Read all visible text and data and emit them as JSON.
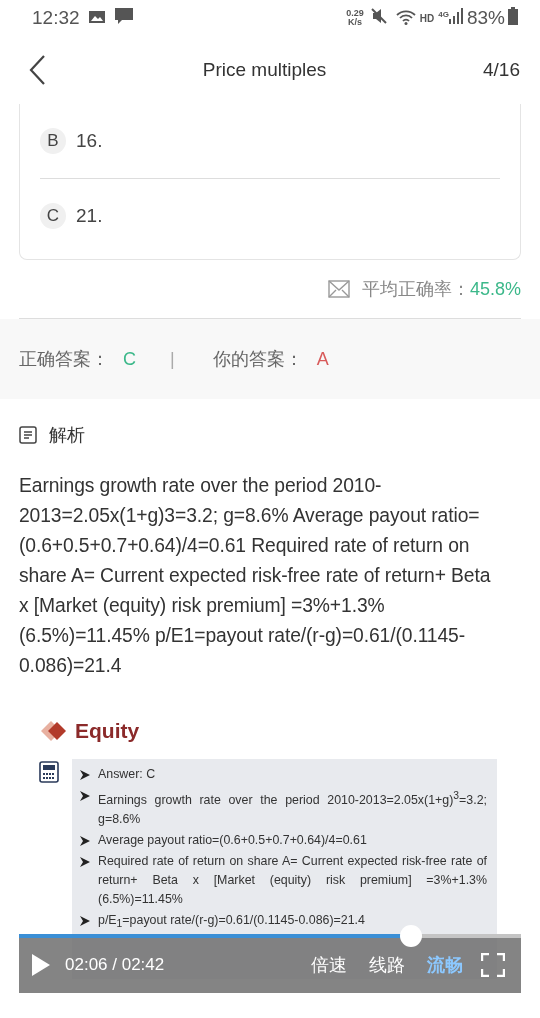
{
  "status_bar": {
    "time": "12:32",
    "speed": "0.29",
    "speed_unit": "K/s",
    "network_hd": "HD",
    "network_gen": "4G",
    "battery": "83%"
  },
  "header": {
    "title": "Price multiples",
    "counter": "4/16"
  },
  "options": [
    {
      "letter": "B",
      "text": "16."
    },
    {
      "letter": "C",
      "text": "21."
    }
  ],
  "accuracy": {
    "label": "平均正确率：",
    "value": "45.8%"
  },
  "answers": {
    "correct_label": "正确答案：",
    "correct": "C",
    "separator": "|",
    "yours_label": "你的答案：",
    "yours": "A"
  },
  "analysis": {
    "heading": "解析",
    "text": "Earnings growth rate over the period 2010-2013=2.05x(1+g)3=3.2; g=8.6% Average payout ratio=(0.6+0.5+0.7+0.64)/4=0.61 Required rate of return on share A= Current expected risk-free rate of return+ Beta x [Market (equity) risk premium] =3%+1.3%(6.5%)=11.45% p/E1=payout rate/(r-g)=0.61/(0.1145-0.086)=21.4"
  },
  "video": {
    "slide_title": "Equity",
    "bullets": [
      "Answer: C",
      "Earnings growth rate over the period 2010-2013=2.05x(1+g)$^{3}$=3.2; g=8.6%",
      "Average payout ratio=(0.6+0.5+0.7+0.64)/4=0.61",
      "Required rate of return on share A= Current expected risk-free rate of return+ Beta x [Market (equity) risk premium] =3%+1.3%(6.5%)=11.45%",
      "p/E$_{1}$=payout rate/(r-g)=0.61/(0.1145-0.086)=21.4"
    ],
    "time": "02:06 / 02:42",
    "level": 0.78,
    "controls": [
      {
        "label": "倍速",
        "selected": false
      },
      {
        "label": "线路",
        "selected": false
      },
      {
        "label": "流畅",
        "selected": true
      }
    ]
  }
}
